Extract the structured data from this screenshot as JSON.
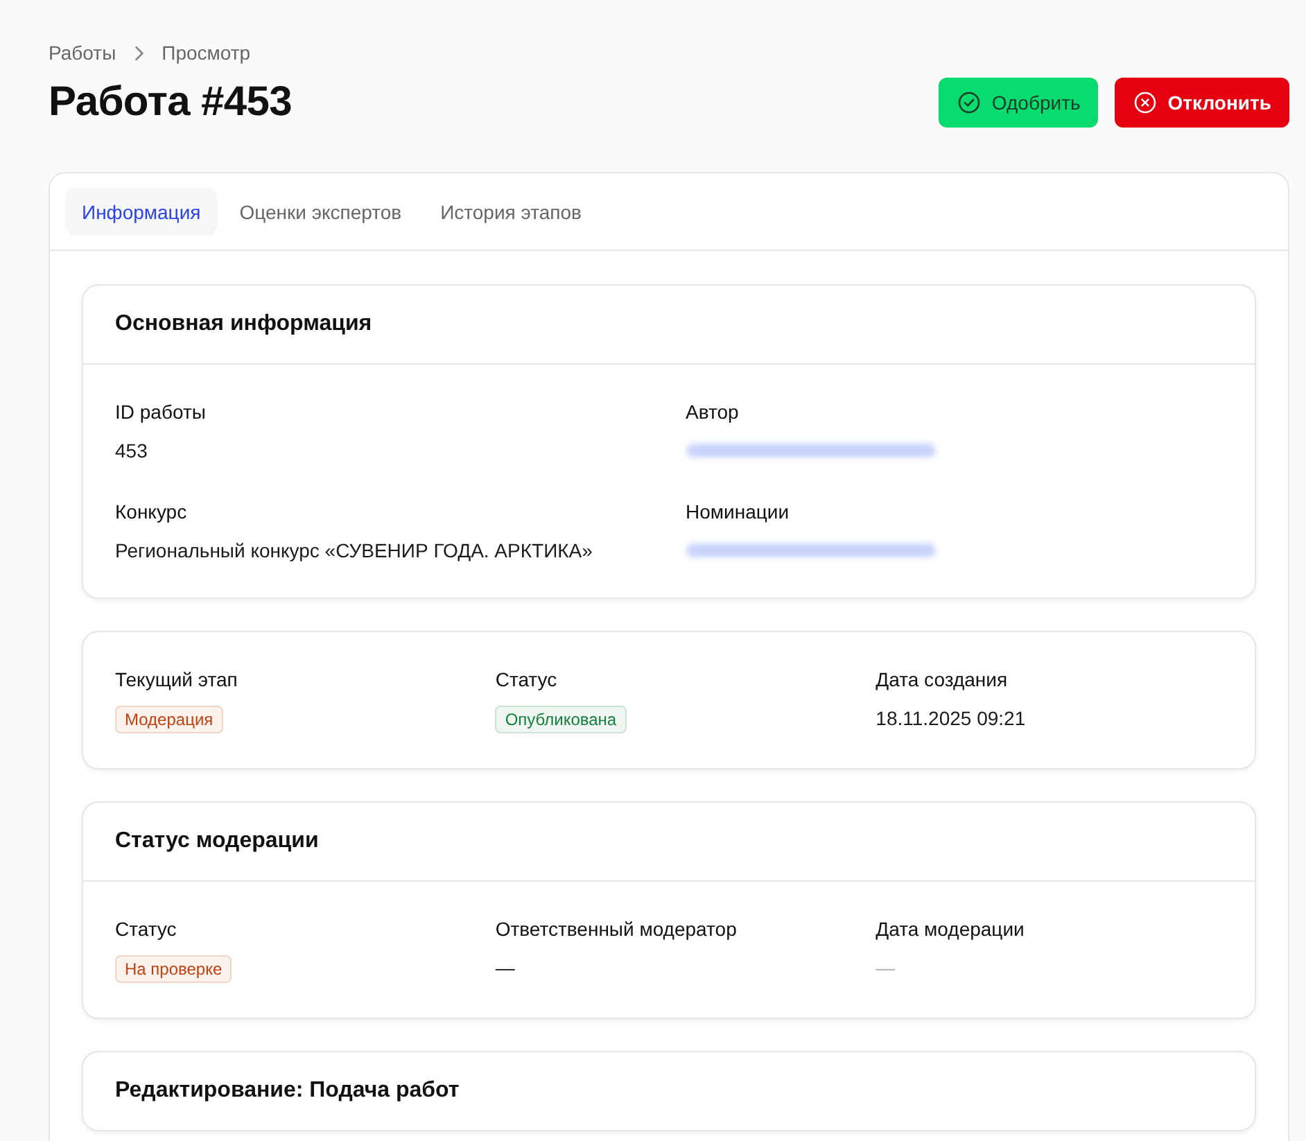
{
  "breadcrumbs": [
    {
      "label": "Работы"
    },
    {
      "label": "Просмотр"
    }
  ],
  "title": "Работа #453",
  "actions": [
    {
      "label": "Одобрить",
      "kind": "approve"
    },
    {
      "label": "Отклонить",
      "kind": "reject"
    }
  ],
  "tabs": [
    {
      "label": "Информация",
      "selected": true
    },
    {
      "label": "Оценки экспертов",
      "selected": false
    },
    {
      "label": "История этапов",
      "selected": false
    }
  ],
  "sections": [
    {
      "title": "Основная информация",
      "rows": [
        [
          {
            "label": "ID работы",
            "kind": "text",
            "value": "453"
          },
          {
            "label": "Автор",
            "kind": "redacted"
          }
        ],
        [
          {
            "label": "Конкурс",
            "kind": "text",
            "value": "Региональный конкурс «СУВЕНИР ГОДА. АРКТИКА»"
          },
          {
            "label": "Номинации",
            "kind": "redacted"
          }
        ]
      ]
    },
    {
      "rows": [
        [
          {
            "label": "Текущий этап",
            "kind": "badge",
            "value": "Модерация",
            "color": "#c2410c"
          },
          {
            "label": "Статус",
            "kind": "badge",
            "value": "Опубликована",
            "color": "#15803d"
          },
          {
            "label": "Дата создания",
            "kind": "text",
            "value": "18.11.2025 09:21"
          }
        ]
      ]
    },
    {
      "title": "Статус модерации",
      "rows": [
        [
          {
            "label": "Статус",
            "kind": "badge",
            "value": "На проверке",
            "color": "#c2410c"
          },
          {
            "label": "Ответственный модератор",
            "kind": "text",
            "value": "—",
            "muted": false
          },
          {
            "label": "Дата модерации",
            "kind": "text",
            "value": "—",
            "muted": true
          }
        ]
      ]
    },
    {
      "title": "Редактирование: Подача работ"
    }
  ]
}
